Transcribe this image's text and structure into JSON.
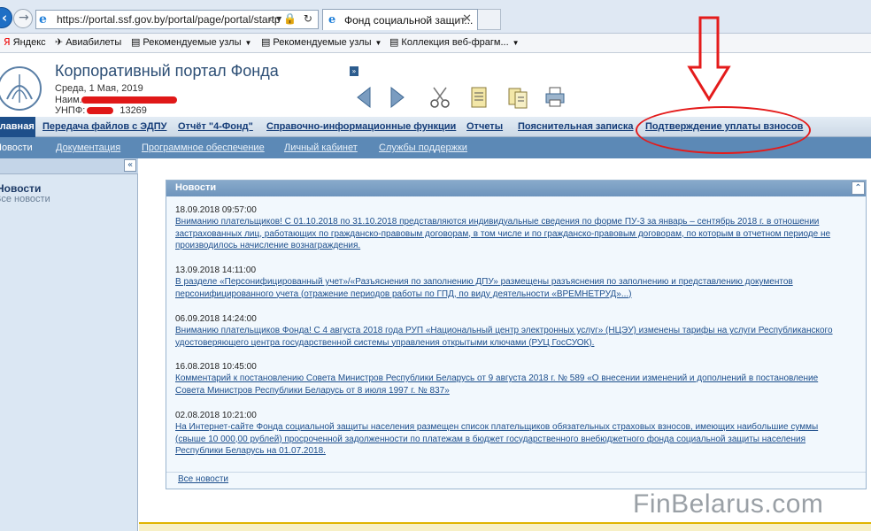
{
  "browser": {
    "url": "https://portal.ssf.gov.by/portal/page/portal/startp",
    "address_icons": "⌕▾🔒 ↻",
    "tab_title": "Фонд социальной защит...",
    "tab_close": "✕",
    "favorites": [
      {
        "label": "Яндекс",
        "glyph": "Я"
      },
      {
        "label": "Авиабилеты",
        "glyph": "✈"
      },
      {
        "label": "Рекомендуемые узлы",
        "glyph": "▤"
      },
      {
        "label": "Рекомендуемые узлы",
        "glyph": "▤"
      },
      {
        "label": "Коллекция веб-фрагм...",
        "glyph": "▤"
      }
    ]
  },
  "header": {
    "title": "Корпоративный портал Фонда",
    "date": "Среда, 1 Мая, 2019",
    "name_label": "Наим...",
    "unp_label": "УНПФ:",
    "unp_value": "13269",
    "small_button": "»"
  },
  "main_nav": [
    {
      "label": "Главная",
      "active": true
    },
    {
      "label": "Передача файлов с ЭДПУ"
    },
    {
      "label": "Отчёт \"4-Фонд\""
    },
    {
      "label": "Справочно-информационные функции"
    },
    {
      "label": "Отчеты"
    },
    {
      "label": "Пояснительная записка"
    },
    {
      "label": "Подтверждение уплаты взносов"
    }
  ],
  "sub_nav": [
    {
      "label": "Новости",
      "active": true
    },
    {
      "label": "Документация"
    },
    {
      "label": "Программное обеспечение"
    },
    {
      "label": "Личный кабинет"
    },
    {
      "label": "Службы поддержки"
    }
  ],
  "sidebar": {
    "collapse": "«",
    "title": "Новости",
    "link": "Все новости"
  },
  "news": {
    "panel_title": "Новости",
    "collapse": "⌃",
    "all_link": "Все новости",
    "items": [
      {
        "date": "18.09.2018 09:57:00",
        "text": "Вниманию плательщиков! С 01.10.2018 по 31.10.2018 представляются индивидуальные сведения по форме ПУ-3 за январь – сентябрь 2018 г. в отношении застрахованных лиц, работающих по гражданско-правовым договорам, в том числе и по гражданско-правовым договорам, по которым в отчетном периоде не производилось начисление вознаграждения."
      },
      {
        "date": "13.09.2018 14:11:00",
        "text": "В разделе «Персонифицированный учет»/«Разъяснения по заполнению ДПУ» размещены разъяснения по заполнению и представлению документов персонифицированного учета (отражение периодов работы по ГПД, по виду деятельности «ВРЕМНЕТРУД»...)"
      },
      {
        "date": "06.09.2018 14:24:00",
        "text": "Вниманию плательщиков Фонда! С 4 августа 2018 года РУП «Национальный центр электронных услуг» (НЦЭУ) изменены тарифы на услуги Республиканского удостоверяющего центра государственной системы управления открытыми ключами (РУЦ ГосСУОК)."
      },
      {
        "date": "16.08.2018 10:45:00",
        "text": "Комментарий к постановлению Совета Министров Республики Беларусь от 9 августа 2018 г. № 589 «О внесении изменений и дополнений в постановление Совета Министров Республики Беларусь от 8 июля 1997 г. № 837»"
      },
      {
        "date": "02.08.2018 10:21:00",
        "text": "На Интернет-сайте Фонда социальной защиты населения размещен список плательщиков обязательных страховых взносов, имеющих наибольшие суммы (свыше 10 000,00 рублей) просроченной задолженности по платежам в бюджет государственного внебюджетного фонда социальной защиты населения Республики Беларусь на 01.07.2018."
      }
    ]
  },
  "watermark": "FinBelarus.com",
  "colors": {
    "annotation_red": "#e41b1b",
    "nav_dark": "#1e4f8a",
    "sub_nav_bg": "#5c89b6",
    "link": "#1c4e8c"
  },
  "toolbar_icons": [
    "back-arrow-icon",
    "forward-arrow-icon",
    "scissors-icon",
    "document-icon",
    "documents-icon",
    "printer-icon"
  ]
}
